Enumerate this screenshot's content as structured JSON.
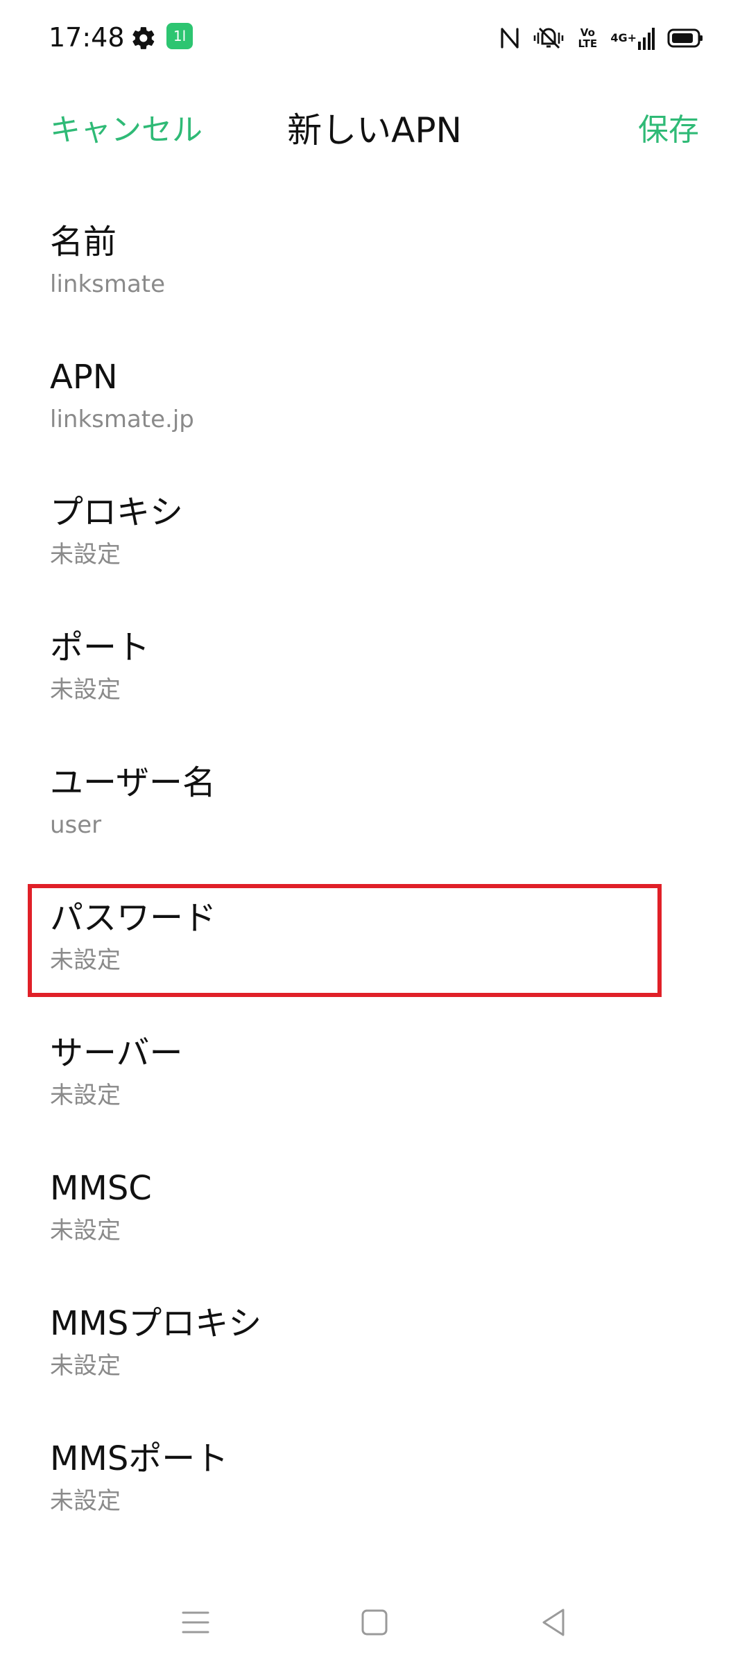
{
  "status_bar": {
    "time": "17:48",
    "app_badge": "1l",
    "icons": [
      "gear-icon",
      "app-notification-icon",
      "nfc-icon",
      "vibrate-icon",
      "volte-icon",
      "signal-4g-icon",
      "battery-icon"
    ],
    "volte_text": "Vo LTE",
    "network_text": "4G+"
  },
  "header": {
    "cancel_label": "キャンセル",
    "title": "新しいAPN",
    "save_label": "保存",
    "accent_color": "#2fba76"
  },
  "fields": [
    {
      "label": "名前",
      "value": "linksmate"
    },
    {
      "label": "APN",
      "value": "linksmate.jp"
    },
    {
      "label": "プロキシ",
      "value": "未設定"
    },
    {
      "label": "ポート",
      "value": "未設定"
    },
    {
      "label": "ユーザー名",
      "value": "user"
    },
    {
      "label": "パスワード",
      "value": "未設定"
    },
    {
      "label": "サーバー",
      "value": "未設定"
    },
    {
      "label": "MMSC",
      "value": "未設定"
    },
    {
      "label": "MMSプロキシ",
      "value": "未設定"
    },
    {
      "label": "MMSポート",
      "value": "未設定"
    }
  ],
  "highlight": {
    "target": "パスワード",
    "color": "#e02028"
  },
  "nav_bar": {
    "buttons": [
      "menu-icon",
      "home-icon",
      "back-icon"
    ]
  }
}
